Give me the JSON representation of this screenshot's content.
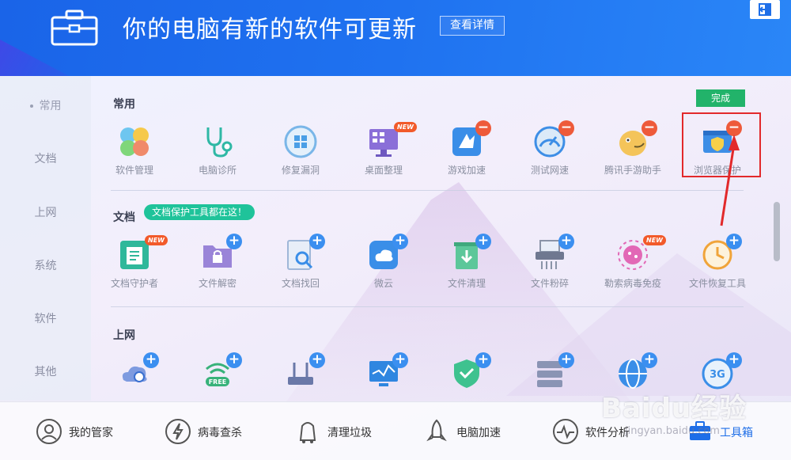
{
  "header": {
    "title": "你的电脑有新的软件可更新",
    "detail_button": "查看详情"
  },
  "sidebar": {
    "items": [
      {
        "label": "常用",
        "active": true
      },
      {
        "label": "文档"
      },
      {
        "label": "上网"
      },
      {
        "label": "系统"
      },
      {
        "label": "软件"
      },
      {
        "label": "其他"
      }
    ]
  },
  "sections": {
    "common": {
      "title": "常用",
      "done_button": "完成",
      "tools": [
        {
          "label": "软件管理",
          "badge": ""
        },
        {
          "label": "电脑诊所",
          "badge": ""
        },
        {
          "label": "修复漏洞",
          "badge": ""
        },
        {
          "label": "桌面整理",
          "badge": "NEW"
        },
        {
          "label": "游戏加速",
          "badge": "−"
        },
        {
          "label": "测试网速",
          "badge": "−"
        },
        {
          "label": "腾讯手游助手",
          "badge": "−"
        },
        {
          "label": "浏览器保护",
          "badge": "−"
        }
      ]
    },
    "docs": {
      "title": "文档",
      "tip": "文档保护工具都在这！",
      "tools": [
        {
          "label": "文档守护者",
          "badge": "NEW"
        },
        {
          "label": "文件解密",
          "badge": "+"
        },
        {
          "label": "文档找回",
          "badge": "+"
        },
        {
          "label": "微云",
          "badge": "+"
        },
        {
          "label": "文件清理",
          "badge": "+"
        },
        {
          "label": "文件粉碎",
          "badge": "+"
        },
        {
          "label": "勒索病毒免疫",
          "badge": "NEW"
        },
        {
          "label": "文件恢复工具",
          "badge": "+"
        }
      ]
    },
    "web": {
      "title": "上网",
      "tools": [
        {
          "label": "",
          "badge": "+"
        },
        {
          "label": "FREE",
          "badge": "+"
        },
        {
          "label": "",
          "badge": "+"
        },
        {
          "label": "",
          "badge": "+"
        },
        {
          "label": "",
          "badge": "+"
        },
        {
          "label": "",
          "badge": "+"
        },
        {
          "label": "",
          "badge": "+"
        },
        {
          "label": "3G",
          "badge": "+"
        }
      ]
    }
  },
  "bottom_nav": [
    {
      "label": "我的管家"
    },
    {
      "label": "病毒查杀"
    },
    {
      "label": "清理垃圾"
    },
    {
      "label": "电脑加速"
    },
    {
      "label": "软件分析"
    },
    {
      "label": "工具箱",
      "active": true
    }
  ],
  "watermark": {
    "text": "Baidu经验",
    "sub": "jingyan.baidu.com"
  },
  "colors": {
    "header_blue": "#1f72f0",
    "accent_green": "#22b36a",
    "badge_blue": "#3b8ff0",
    "badge_red": "#ee5a3a",
    "highlight_red": "#e2292b"
  }
}
